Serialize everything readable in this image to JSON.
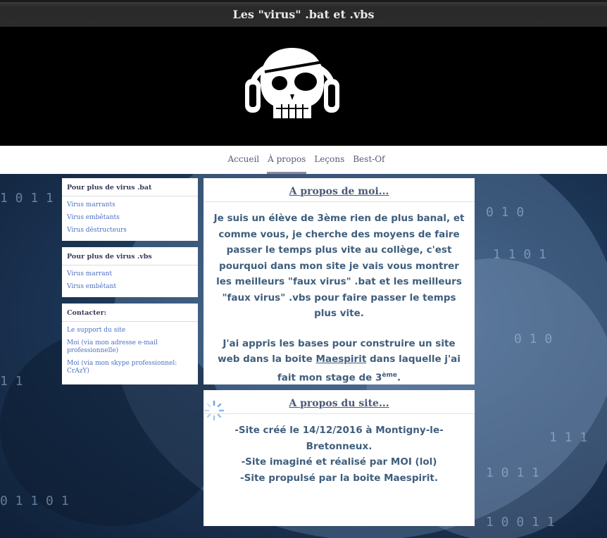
{
  "header": {
    "title": "Les \"virus\" .bat et .vbs"
  },
  "nav": {
    "items": [
      {
        "label": "Accueil",
        "active": false
      },
      {
        "label": "À propos",
        "active": true
      },
      {
        "label": "Leçons",
        "active": false
      },
      {
        "label": "Best-Of",
        "active": false
      }
    ]
  },
  "sidebar": {
    "bat": {
      "title": "Pour plus de virus .bat",
      "links": [
        "Virus marrants",
        "Virus embêtants",
        "Virus déstructeurs"
      ]
    },
    "vbs": {
      "title": "Pour plus de virus .vbs",
      "links": [
        "Virus marrant",
        "Virus embêtant"
      ]
    },
    "contact": {
      "title": "Contacter:",
      "links": [
        "Le support du site",
        "Moi (via mon adresse e-mail professionnelle)",
        "Moi (via mon skype professionnel: CrAzY)"
      ]
    }
  },
  "about_me": {
    "title": "A propos de moi...",
    "para1": "Je suis un élève de 3ème rien de plus banal, et comme vous, je cherche des moyens de faire passer le temps plus vite au collège, c'est pourquoi dans mon site je vais vous montrer les meilleurs \"faux virus\" .bat et les meilleurs \"faux virus\" .vbs pour faire passer le temps plus vite.",
    "para2_before": "J'ai appris les bases pour construire un site web dans la boite ",
    "para2_link": "Maespirit",
    "para2_after": " dans laquelle j'ai fait mon stage de 3",
    "para2_sup": "ème",
    "para2_end": "."
  },
  "about_site": {
    "title": "A propos du site...",
    "lines": [
      "-Site créé le 14/12/2016 à Montigny-le-Bretonneux.",
      "-Site imaginé et réalisé par MOI (lol)",
      "-Site propulsé par la boite Maespirit."
    ]
  },
  "icons": {
    "logo": "pirate-skull-headphones-icon",
    "loader": "loading-spinner-icon"
  },
  "colors": {
    "link": "#4b6fc4",
    "panel_text": "#3f5e7d",
    "titlebar": "#2b2b2b"
  }
}
